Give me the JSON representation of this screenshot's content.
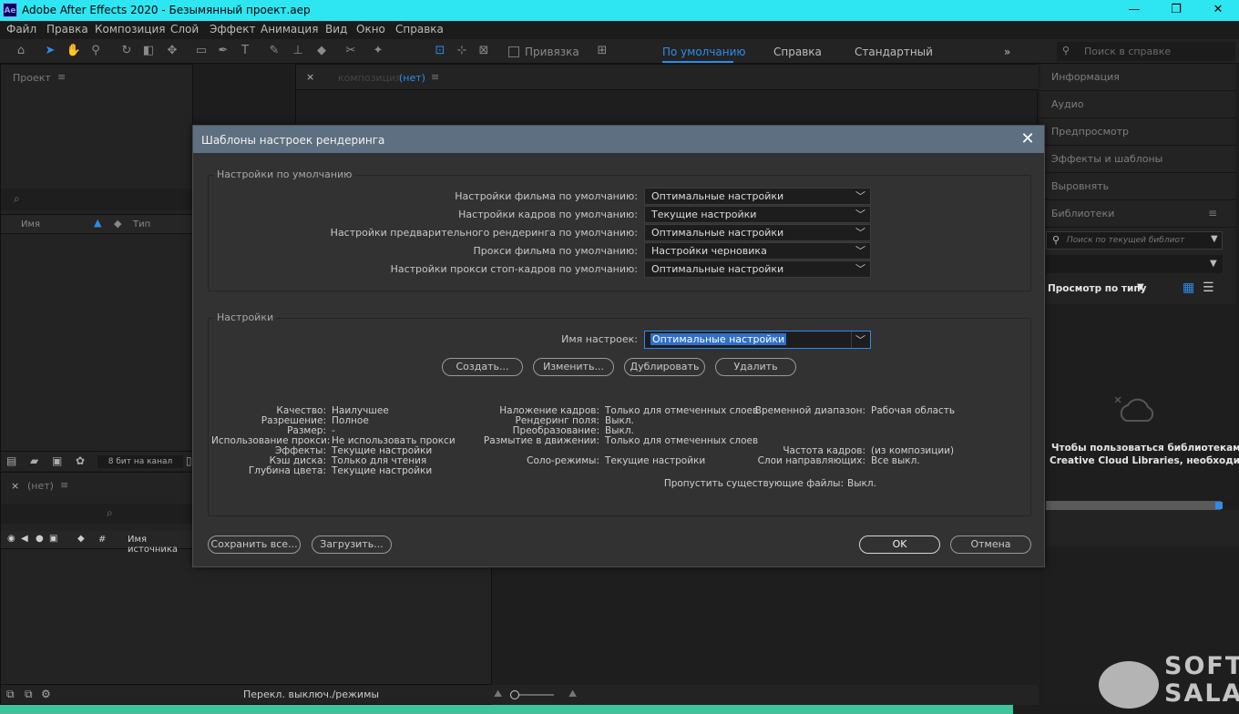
{
  "window": {
    "app_icon": "Ae",
    "title": "Adobe After Effects 2020 - Безымянный проект.aep",
    "minimize": "—",
    "maximize": "❐",
    "close": "✕"
  },
  "menu": [
    "Файл",
    "Правка",
    "Композиция",
    "Слой",
    "Эффект",
    "Анимация",
    "Вид",
    "Окно",
    "Справка"
  ],
  "toolbar": {
    "snap_label": "Привязка",
    "workspaces": [
      "По умолчанию",
      "Справка",
      "Стандартный"
    ],
    "more": "»",
    "search_placeholder": "Поиск в справке"
  },
  "project_panel": {
    "title": "Проект",
    "search_icon": "⌕",
    "col_name": "Имя",
    "col_type": "Тип",
    "bit_depth": "8 бит на канал"
  },
  "comp_panel": {
    "tab_label": "композиция",
    "tab_value": "(нет)"
  },
  "timeline_panel": {
    "tab": "(нет)",
    "col_hash": "#",
    "col_source": "Имя источника",
    "switch_modes": "Перекл. выключ./режимы"
  },
  "right_panel": {
    "items": [
      "Информация",
      "Аудио",
      "Предпросмотр",
      "Эффекты и шаблоны",
      "Выровнять",
      "Библиотеки"
    ],
    "lib_search_placeholder": "Поиск по текущей библиот",
    "view_by_type": "Просмотр по типу",
    "cc_message_line1": "Чтобы пользоваться библиотеками",
    "cc_message_line2": "Creative Cloud Libraries, необходимо"
  },
  "dialog": {
    "title": "Шаблоны настроек рендеринга",
    "defaults_group": "Настройки по умолчанию",
    "defaults": [
      {
        "label": "Настройки фильма по умолчанию:",
        "value": "Оптимальные настройки"
      },
      {
        "label": "Настройки кадров по умолчанию:",
        "value": "Текущие настройки"
      },
      {
        "label": "Настройки предварительного рендеринга по умолчанию:",
        "value": "Оптимальные настройки"
      },
      {
        "label": "Прокси фильма по умолчанию:",
        "value": "Настройки черновика"
      },
      {
        "label": "Настройки прокси стоп-кадров по умолчанию:",
        "value": "Оптимальные настройки"
      }
    ],
    "settings_group": "Настройки",
    "name_label": "Имя настроек:",
    "name_value": "Оптимальные настройки",
    "buttons": {
      "create": "Создать...",
      "edit": "Изменить...",
      "duplicate": "Дублировать",
      "delete": "Удалить"
    },
    "info_col1": [
      {
        "k": "Качество:",
        "v": "Наилучшее"
      },
      {
        "k": "Разрешение:",
        "v": "Полное"
      },
      {
        "k": "Размер:",
        "v": "-"
      },
      {
        "k": "Использование прокси:",
        "v": "Не использовать прокси"
      },
      {
        "k": "Эффекты:",
        "v": "Текущие  настройки"
      },
      {
        "k": "Кэш диска:",
        "v": "Только для чтения"
      },
      {
        "k": "Глубина цвета:",
        "v": "Текущие настройки"
      }
    ],
    "info_col2": [
      {
        "k": "Наложение кадров:",
        "v": "Только для отмеченных слоев"
      },
      {
        "k": "Рендеринг поля:",
        "v": "Выкл."
      },
      {
        "k": "Преобразование:",
        "v": "Выкл."
      },
      {
        "k": "Размытие в движении:",
        "v": "Только для отмеченных слоев"
      },
      {
        "k": "Соло-режимы:",
        "v": "Текущие  настройки"
      }
    ],
    "info_col3": [
      {
        "k": "Временной диапазон:",
        "v": "Рабочая область"
      },
      {
        "k": "Частота кадров:",
        "v": "(из композиции)"
      },
      {
        "k": "Слои направляющих:",
        "v": "Все выкл."
      }
    ],
    "skip_label": "Пропустить существующие файлы:",
    "skip_value": "Выкл.",
    "save_all": "Сохранить все...",
    "load": "Загрузить...",
    "ok": "OK",
    "cancel": "Отмена"
  },
  "watermark": {
    "line1": "SOFT",
    "line2": "SALAD"
  }
}
